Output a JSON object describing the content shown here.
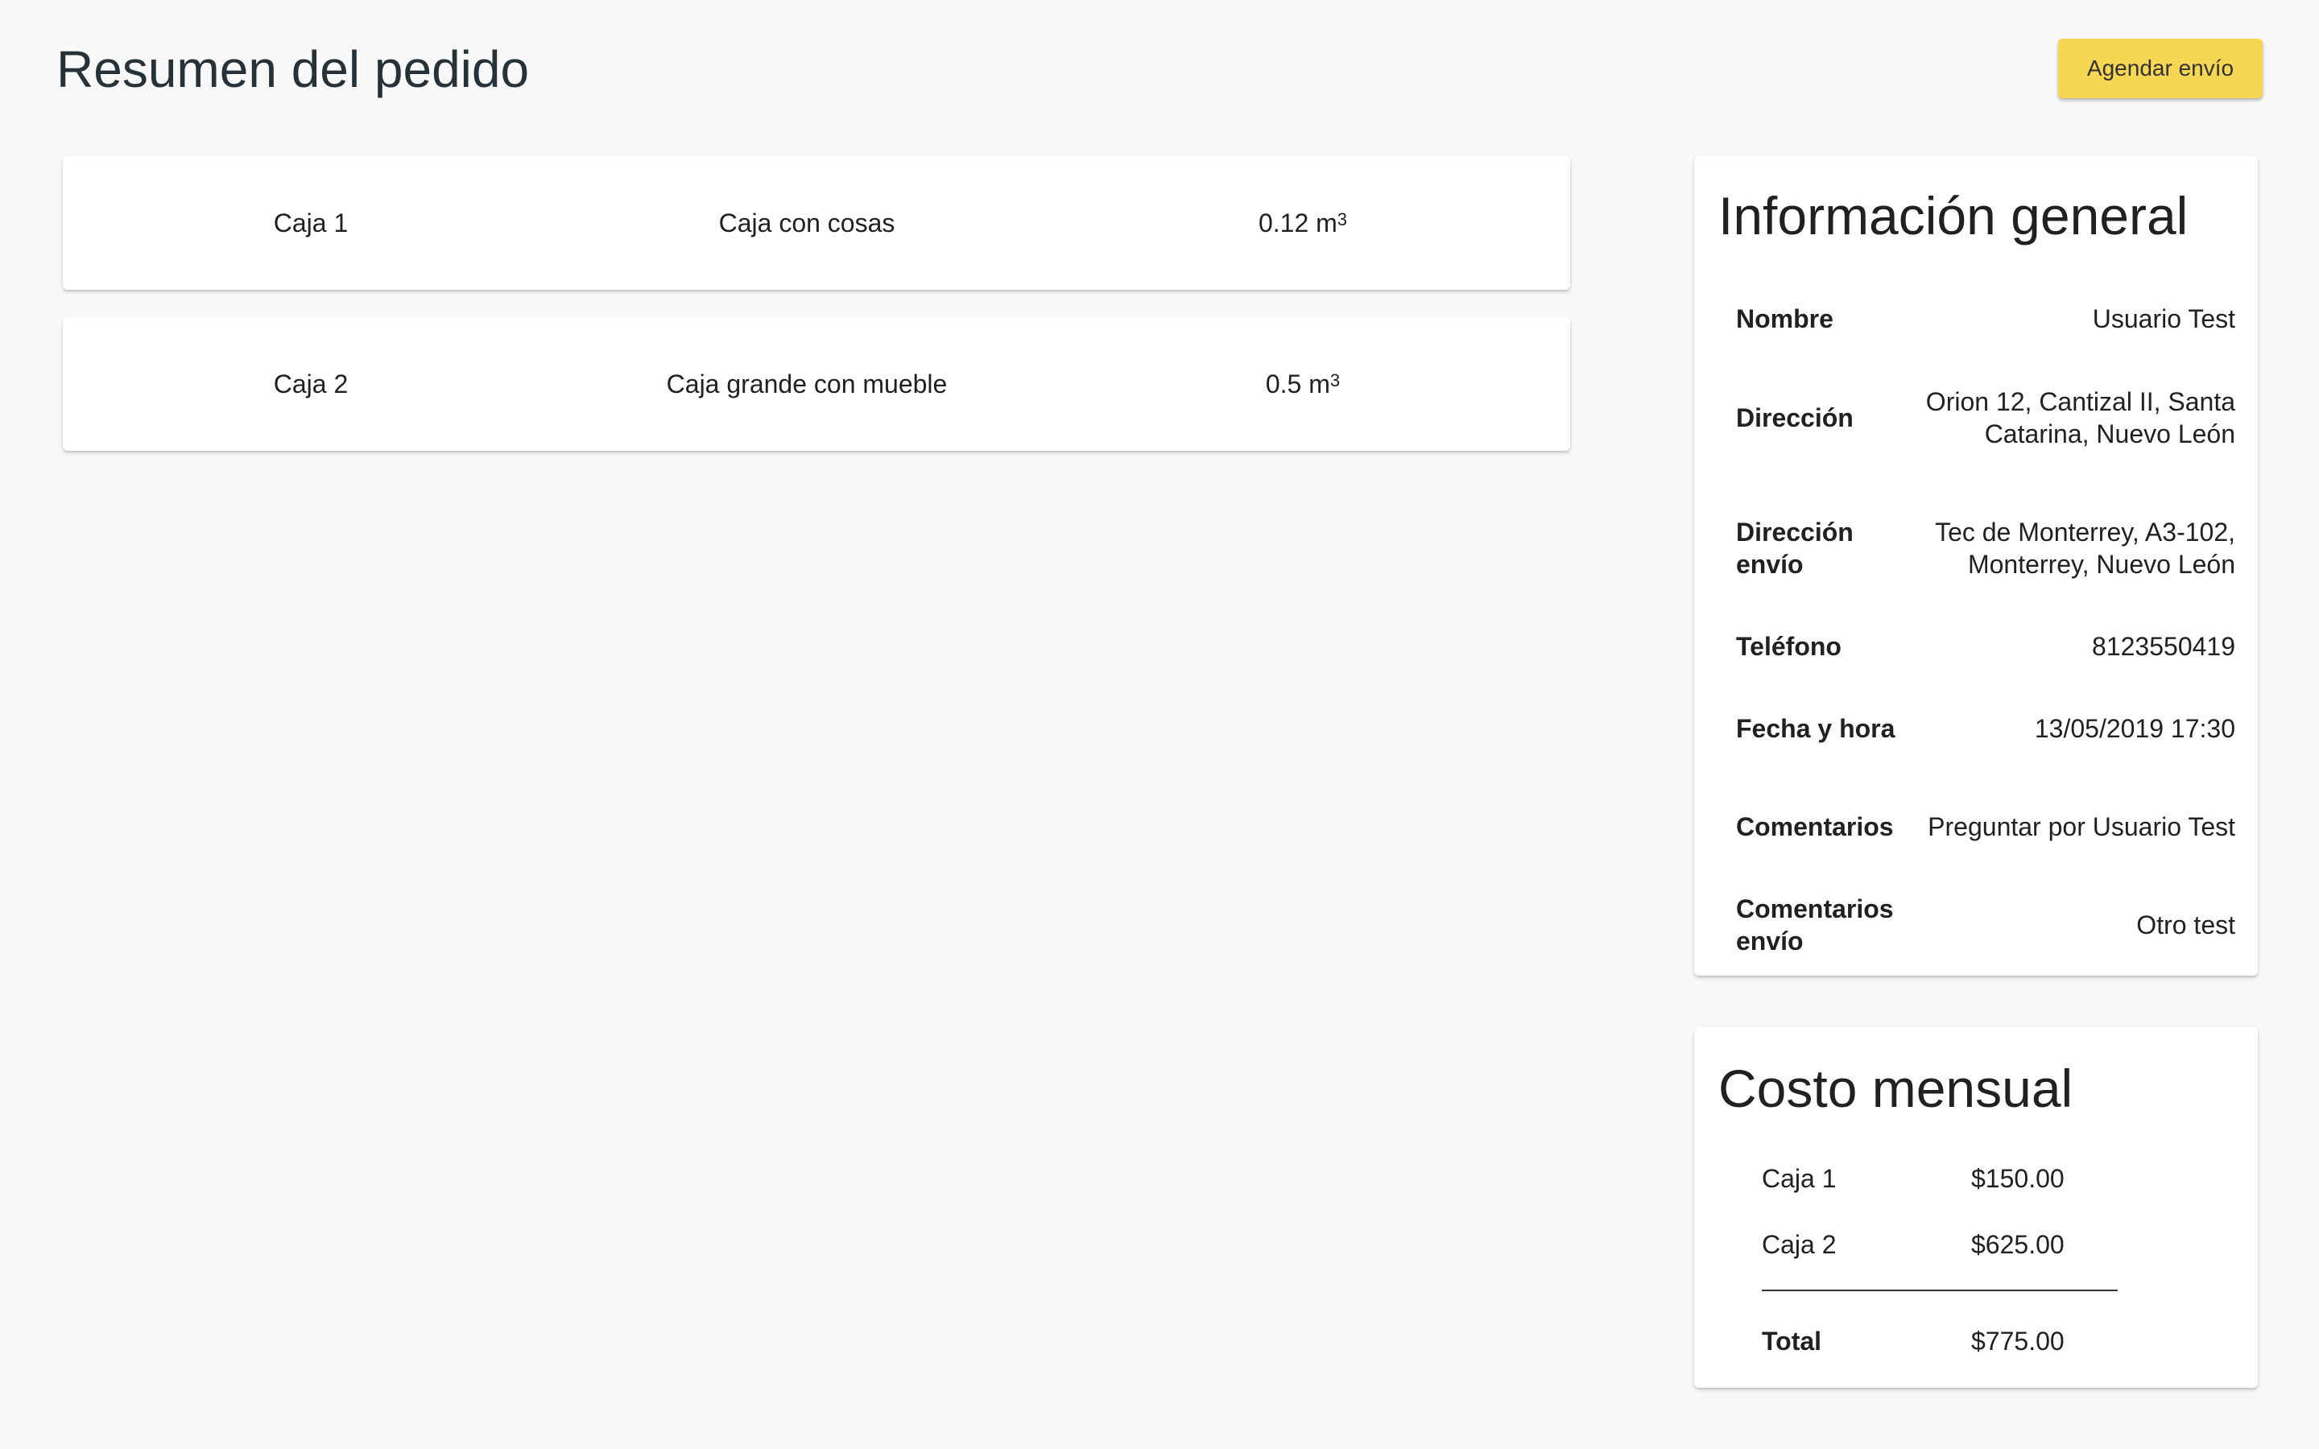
{
  "header": {
    "title": "Resumen del pedido",
    "schedule_button": "Agendar envío"
  },
  "items": [
    {
      "name": "Caja 1",
      "description": "Caja con cosas",
      "volume": "0.12 m",
      "unit_exp": "3"
    },
    {
      "name": "Caja 2",
      "description": "Caja grande con mueble",
      "volume": "0.5 m",
      "unit_exp": "3"
    }
  ],
  "info": {
    "title": "Información general",
    "rows": [
      {
        "label": "Nombre",
        "value": "Usuario Test"
      },
      {
        "label": "Dirección",
        "value": "Orion 12, Cantizal II, Santa Catarina, Nuevo León"
      },
      {
        "label": "Dirección envío",
        "value": "Tec de Monterrey, A3-102, Monterrey, Nuevo León"
      },
      {
        "label": "Teléfono",
        "value": "8123550419"
      },
      {
        "label": "Fecha y hora",
        "value": "13/05/2019 17:30"
      },
      {
        "label": "Comentarios",
        "value": "Preguntar por Usuario Test"
      },
      {
        "label": "Comentarios envío",
        "value": "Otro test"
      }
    ]
  },
  "cost": {
    "title": "Costo mensual",
    "lines": [
      {
        "label": "Caja 1",
        "amount": "$150.00"
      },
      {
        "label": "Caja 2",
        "amount": "$625.00"
      }
    ],
    "total_label": "Total",
    "total_amount": "$775.00"
  },
  "colors": {
    "accent": "#f6d653",
    "background": "#f8f8f8",
    "card": "#ffffff"
  }
}
